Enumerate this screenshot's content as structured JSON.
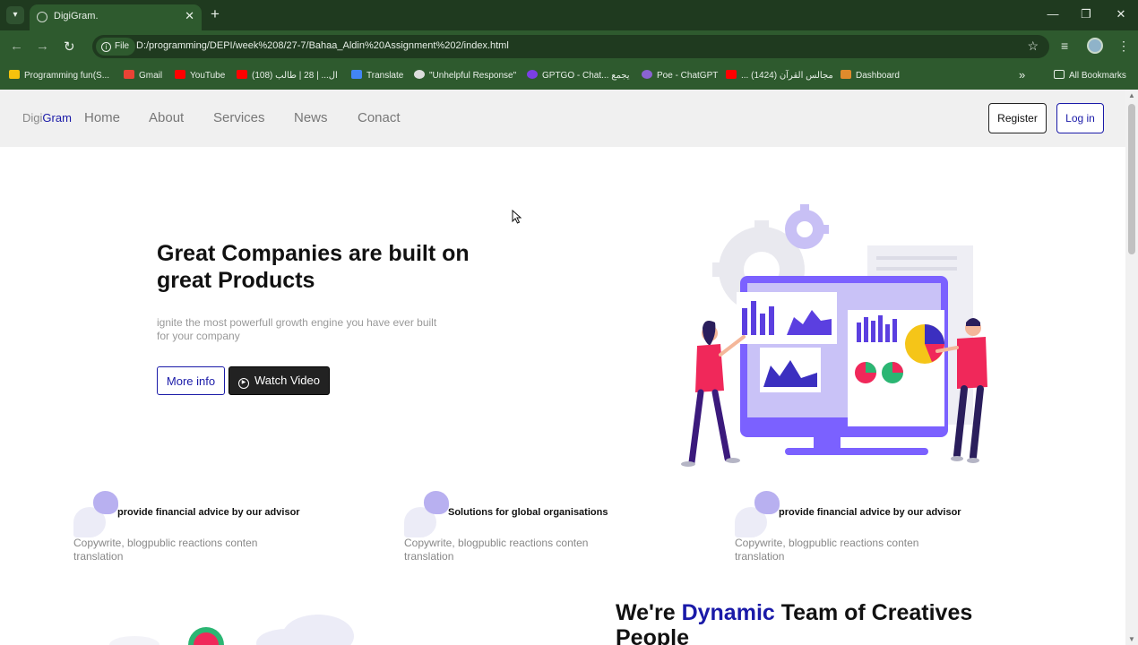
{
  "browser": {
    "tab_title": "DigiGram.",
    "tab_close": "✕",
    "new_tab": "+",
    "file_chip": "File",
    "url": "D:/programming/DEPI/week%208/27-7/Bahaa_Aldin%20Assignment%202/index.html",
    "window": {
      "minimize": "—",
      "restore": "❐",
      "close": "✕"
    },
    "bookmarks": [
      {
        "label": "Programming fun(S...",
        "color": "#f4c20d"
      },
      {
        "label": "Gmail",
        "color": "#ea4335"
      },
      {
        "label": "YouTube",
        "color": "#ff0000"
      },
      {
        "label": "ال... | 28 | طالب (108)",
        "color": "#ff0000"
      },
      {
        "label": "Translate",
        "color": "#4285f4"
      },
      {
        "label": "\"Unhelpful Response\"",
        "color": "#dddddd"
      },
      {
        "label": "GPTGO - Chat... يجمع",
        "color": "#7b3fe4"
      },
      {
        "label": "Poe - ChatGPT",
        "color": "#8a63d2"
      },
      {
        "label": "... مجالس القرآن (1424)",
        "color": "#ff0000"
      },
      {
        "label": "Dashboard",
        "color": "#e08b2c"
      }
    ],
    "bookmarks_more": "»",
    "all_bookmarks": "All Bookmarks"
  },
  "site": {
    "brand_prefix": "Digi",
    "brand_highlight": "Gram",
    "nav": [
      "Home",
      "About",
      "Services",
      "News",
      "Conact"
    ],
    "register": "Register",
    "login": "Log in"
  },
  "hero": {
    "title": "Great Companies are built on great Products",
    "subtitle": "ignite the most powerfull growth engine you have ever built for your company",
    "more_info": "More info",
    "watch_video": "Watch Video"
  },
  "features": [
    {
      "title": "provide financial advice by our advisor",
      "desc": "Copywrite, blogpublic reactions conten translation"
    },
    {
      "title": "Solutions for global organisations",
      "desc": "Copywrite, blogpublic reactions conten translation"
    },
    {
      "title": "provide financial advice by our advisor",
      "desc": "Copywrite, blogpublic reactions conten translation"
    }
  ],
  "team": {
    "prefix": "We're ",
    "highlight": "Dynamic",
    "suffix": " Team of Creatives People"
  },
  "colors": {
    "brand_blue": "#1a1aa8",
    "illustration_purple": "#7b61ff",
    "accent_pink": "#f0285a",
    "browser_green": "#2e5a2e"
  }
}
